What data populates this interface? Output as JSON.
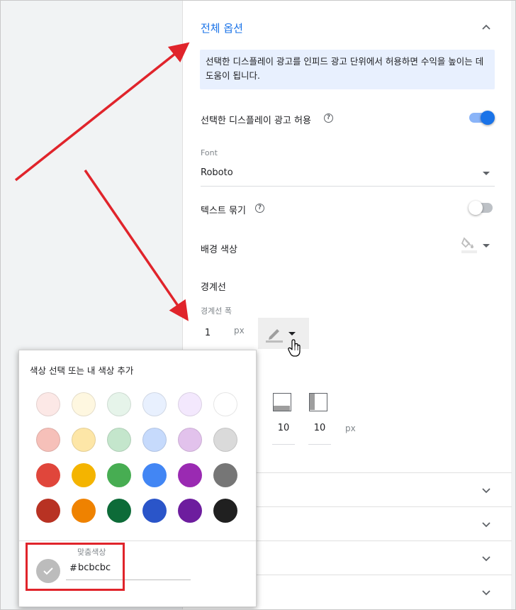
{
  "panel": {
    "section_title": "전체 옵션",
    "info_text": "선택한 디스플레이 광고를 인피드 광고 단위에서 허용하면 수익을 높이는 데 도움이 됩니다.",
    "allow_display_label": "선택한 디스플레이 광고 허용",
    "allow_display_on": true,
    "font_label": "Font",
    "font_value": "Roboto",
    "text_wrap_label": "텍스트 묶기",
    "text_wrap_on": false,
    "bg_color_label": "배경 색상",
    "border_label": "경계선",
    "border_width_label": "경계선 폭",
    "border_width_value": "1",
    "border_width_unit": "px",
    "padding_values": [
      "10",
      "10"
    ],
    "padding_unit": "px",
    "icons": {
      "collapse": "chevron-up-icon",
      "expand": "chevron-down-icon",
      "help": "help-circle-icon",
      "fill": "paint-bucket-icon",
      "pen": "pencil-icon",
      "dropdown": "triangle-down-icon",
      "cursor": "hand-pointer-icon"
    },
    "help_glyph": "?"
  },
  "color_picker": {
    "title": "색상 선택 또는 내 색상 추가",
    "swatches": [
      [
        "#fce8e6",
        "#fef7e0",
        "#e6f4ea",
        "#e8f0fe",
        "#f3e8fd",
        "#ffffff"
      ],
      [
        "#f6c0b9",
        "#fde6a7",
        "#c4e6cc",
        "#c6dafc",
        "#e2c2ec",
        "#dadada"
      ],
      [
        "#e0463b",
        "#f4b400",
        "#47ad52",
        "#4286f4",
        "#9a2ab2",
        "#767676"
      ],
      [
        "#b83223",
        "#ef8200",
        "#0d6b38",
        "#2a55c9",
        "#6d1d9e",
        "#202020"
      ]
    ],
    "custom_label": "맞춤색상",
    "hex_prefix": "#",
    "hex_value": "bcbcbc",
    "custom_color": "#bcbcbc"
  },
  "colors": {
    "accent": "#1a73e8",
    "annotation_red": "#e0242b"
  }
}
